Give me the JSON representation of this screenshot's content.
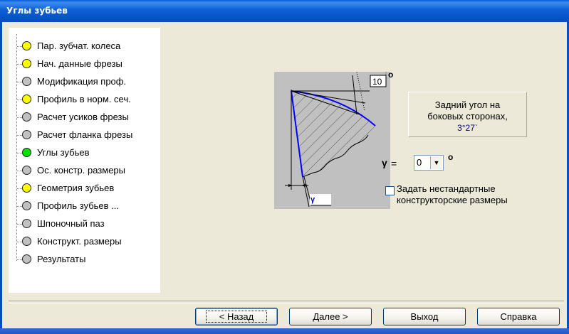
{
  "window": {
    "title": "Углы зубьев"
  },
  "tree": {
    "items": [
      {
        "label": "Пар. зубчат. колеса",
        "color": "#ffff00"
      },
      {
        "label": "Нач. данные фрезы",
        "color": "#ffff00"
      },
      {
        "label": "Модификация проф.",
        "color": "#c0c0c0"
      },
      {
        "label": "Профиль в норм. сеч.",
        "color": "#ffff00"
      },
      {
        "label": "Расчет усиков фрезы",
        "color": "#c0c0c0"
      },
      {
        "label": "Расчет фланка фрезы",
        "color": "#c0c0c0"
      },
      {
        "label": "Углы зубьев",
        "color": "#00e000"
      },
      {
        "label": "Ос. констр. размеры",
        "color": "#c0c0c0"
      },
      {
        "label": "Геометрия зубьев",
        "color": "#ffff00"
      },
      {
        "label": "Профиль зубьев ...",
        "color": "#c0c0c0"
      },
      {
        "label": "Шпоночный паз",
        "color": "#c0c0c0"
      },
      {
        "label": "Конструкт. размеры",
        "color": "#c0c0c0"
      },
      {
        "label": "Результаты",
        "color": "#c0c0c0"
      }
    ]
  },
  "diagram": {
    "angle_value": "10",
    "degree_symbol": "o",
    "gamma_symbol": "γ"
  },
  "info": {
    "line1": "Задний угол на",
    "line2": "боковых сторонах,",
    "value": "3°27`"
  },
  "gamma": {
    "label": "γ",
    "equals": "=",
    "selected": "0",
    "degree_symbol": "o"
  },
  "checkbox": {
    "label_line1": "Задать нестандартные",
    "label_line2": "конструкторские размеры",
    "checked": false
  },
  "buttons": {
    "back": "< Назад",
    "next": "Далее >",
    "exit": "Выход",
    "help": "Справка"
  }
}
